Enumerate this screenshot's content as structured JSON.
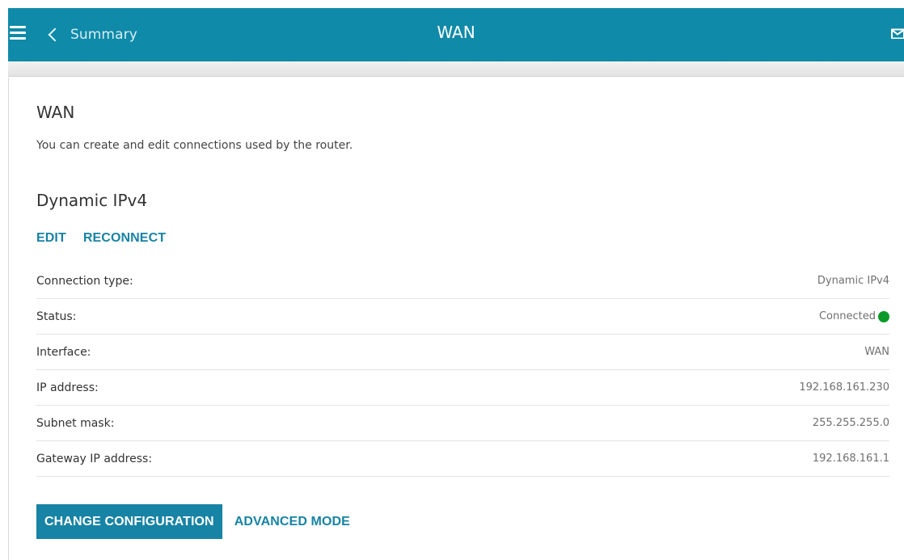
{
  "header": {
    "back_label": "Summary",
    "title": "WAN",
    "menu_icon": "hamburger-menu-icon",
    "back_icon": "chevron-left-icon",
    "mail_icon": "mail-icon",
    "bar_color": "#0f8aa8"
  },
  "page": {
    "title": "WAN",
    "description": "You can create and edit connections used by the router."
  },
  "connection": {
    "name": "Dynamic IPv4",
    "actions": {
      "edit_label": "EDIT",
      "reconnect_label": "RECONNECT"
    },
    "details": [
      {
        "label": "Connection type:",
        "value": "Dynamic IPv4"
      },
      {
        "label": "Status:",
        "value": "Connected"
      },
      {
        "label": "Interface:",
        "value": "WAN"
      },
      {
        "label": "IP address:",
        "value": "192.168.161.230"
      },
      {
        "label": "Subnet mask:",
        "value": "255.255.255.0"
      },
      {
        "label": "Gateway IP address:",
        "value": "192.168.161.1"
      }
    ],
    "status_color": "#0a9a2a"
  },
  "footer": {
    "change_config_label": "CHANGE CONFIGURATION",
    "advanced_mode_label": "ADVANCED MODE",
    "accent_color": "#1783a5"
  }
}
